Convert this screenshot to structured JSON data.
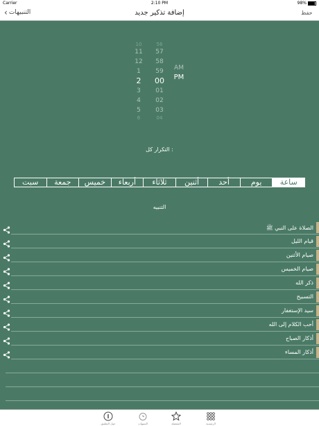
{
  "status_bar": {
    "carrier": "Carrier",
    "time": "2:10 PM",
    "battery": "98%"
  },
  "nav": {
    "save_label": "حفظ",
    "title": "إضافة تذكير جديد",
    "back_label": "التنبيهات"
  },
  "picker": {
    "hours": [
      "10",
      "11",
      "12",
      "1",
      "2",
      "3",
      "4",
      "5",
      "6"
    ],
    "minutes": [
      "56",
      "57",
      "58",
      "59",
      "00",
      "01",
      "02",
      "03",
      "04"
    ],
    "ampm": [
      "AM",
      "PM"
    ],
    "selected_hour": "2",
    "selected_minute": "00",
    "selected_ampm": "PM"
  },
  "repeat_label": "التكرار كل :",
  "repeat_options": [
    "ساعة",
    "يوم",
    "أحد",
    "أثنين",
    "ثلاثاء",
    "أربعاء",
    "خميس",
    "جمعة",
    "سبت"
  ],
  "repeat_selected": "ساعة",
  "section_label": "التنبيه",
  "alerts": [
    {
      "label": "الصلاة على النبي ﷺ",
      "checked": true
    },
    {
      "label": "قيام الليل",
      "checked": false
    },
    {
      "label": "صيام الأثنين",
      "checked": false
    },
    {
      "label": "صيام الخميس",
      "checked": false
    },
    {
      "label": "ذكر الله",
      "checked": false
    },
    {
      "label": "التسبيح",
      "checked": false
    },
    {
      "label": "سيد الإستغفار",
      "checked": false
    },
    {
      "label": "أحب الكلام إلى الله",
      "checked": false
    },
    {
      "label": "أذكار الصباح",
      "checked": false
    },
    {
      "label": "أذكار المساء",
      "checked": false
    }
  ],
  "tabs": [
    {
      "label": "حول التطبيق",
      "icon": "info-circle-icon"
    },
    {
      "label": "التنبيهات",
      "icon": "alarm-clock-icon"
    },
    {
      "label": "المفضلة",
      "icon": "star-icon"
    },
    {
      "label": "الرئيسية",
      "icon": "grid-dots-icon"
    }
  ],
  "colors": {
    "background": "#4a7a66",
    "accent_bar": "#c5b38a"
  }
}
